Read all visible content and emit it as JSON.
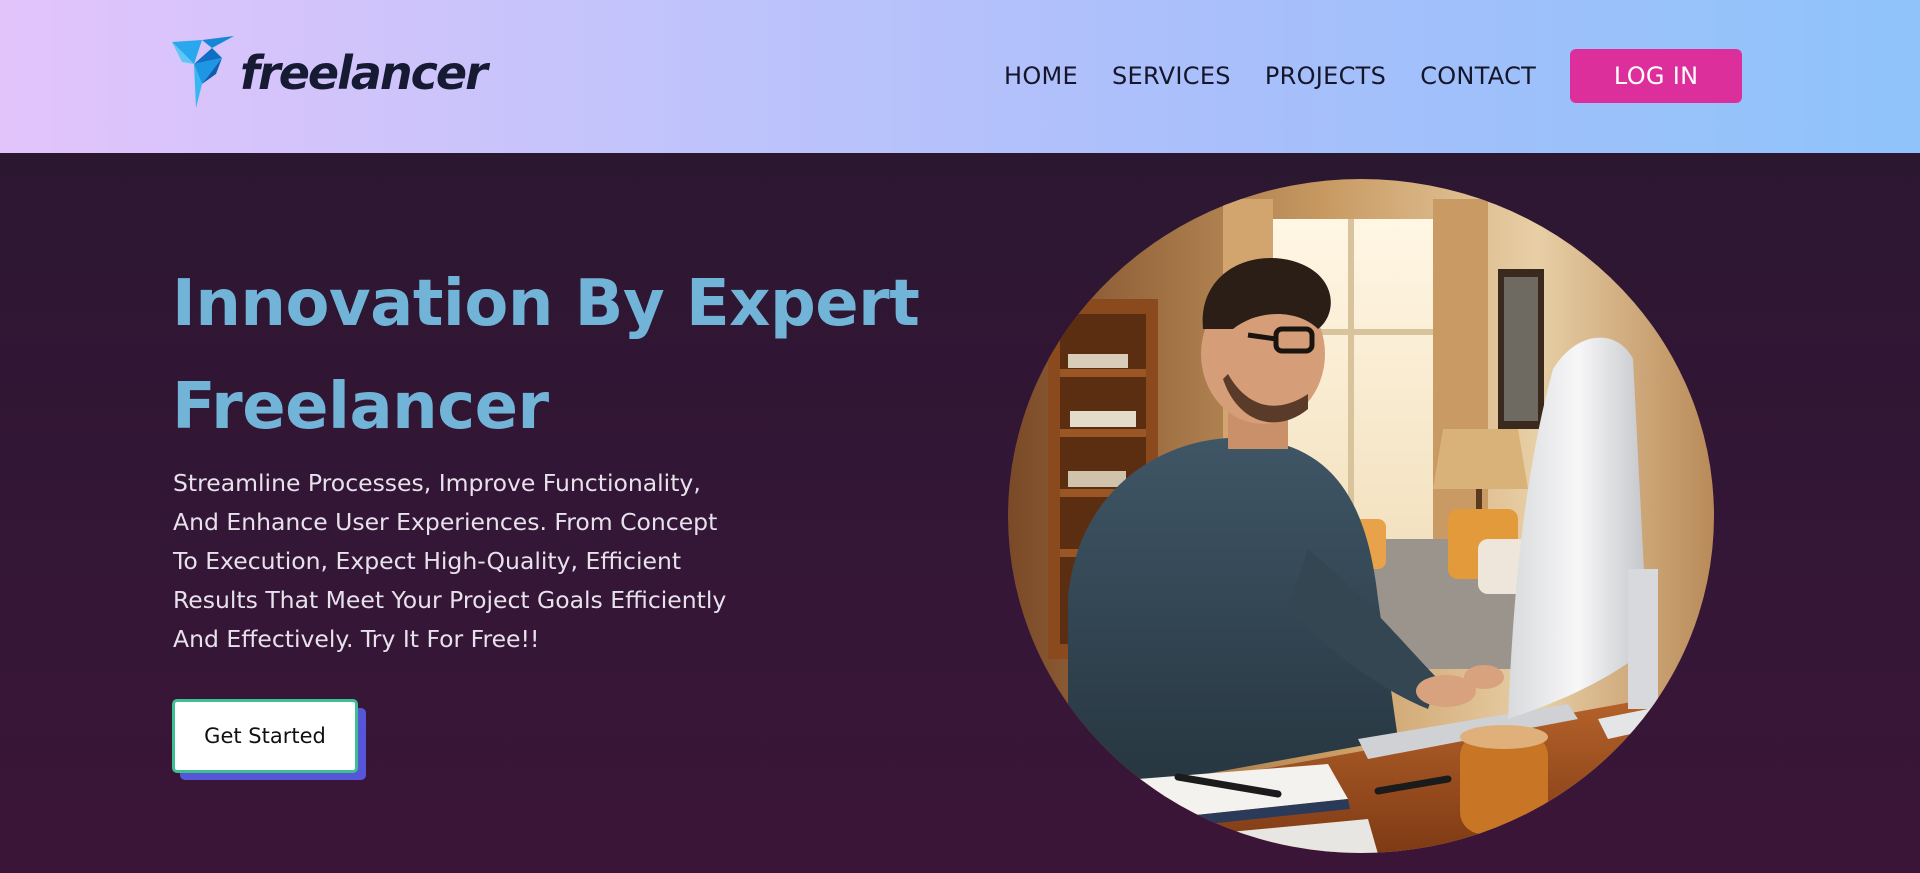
{
  "brand": {
    "name": "freelancer"
  },
  "nav": {
    "items": [
      {
        "label": "HOME"
      },
      {
        "label": "SERVICES"
      },
      {
        "label": "PROJECTS"
      },
      {
        "label": "CONTACT"
      }
    ],
    "login_label": "LOG IN"
  },
  "hero": {
    "headline_line1": "Innovation By Expert",
    "headline_line2": "Freelancer",
    "subtext_lines": [
      "Streamline Processes, Improve Functionality,",
      "And Enhance User Experiences. From Concept",
      "To Execution, Expect High-Quality, Efficient",
      "Results That Meet Your Project Goals Efficiently",
      "And Effectively. Try It For Free!!"
    ],
    "cta_label": "Get Started"
  },
  "colors": {
    "header_gradient_start": "#e2c4fb",
    "header_gradient_end": "#8fc3fa",
    "hero_background": "#2e1731",
    "headline": "#72b4d8",
    "login_button": "#dc2f9c",
    "cta_border": "#3fbe92",
    "cta_shadow": "#5657d8"
  },
  "icons": {
    "logo_mark": "origami-bird-icon"
  }
}
